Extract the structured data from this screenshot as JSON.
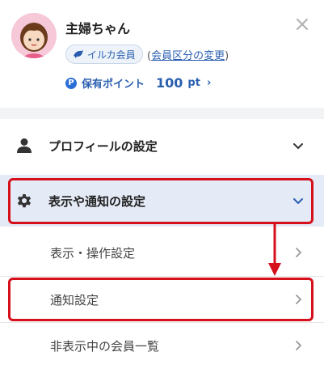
{
  "user": {
    "name": "主婦ちゃん"
  },
  "membership": {
    "badge": "イルカ会員",
    "open_paren": "(",
    "change_link": "会員区分の変更",
    "close_paren": ")"
  },
  "points": {
    "icon_letter": "P",
    "label": "保有ポイント",
    "value": "100",
    "unit": "pt",
    "chevron": "›"
  },
  "menu": {
    "profile": "プロフィールの設定",
    "display": "表示や通知の設定",
    "sub_items": [
      "表示・操作設定",
      "通知設定",
      "非表示中の会員一覧"
    ]
  },
  "colors": {
    "accent": "#2a5fb0",
    "highlight": "#d5101b",
    "selected_bg": "#e4eaf6"
  },
  "icons": {
    "close": "close-icon",
    "profile": "person-icon",
    "display": "gear-icon",
    "chevron_down": "chevron-down-icon",
    "chevron_right": "chevron-right-icon"
  }
}
